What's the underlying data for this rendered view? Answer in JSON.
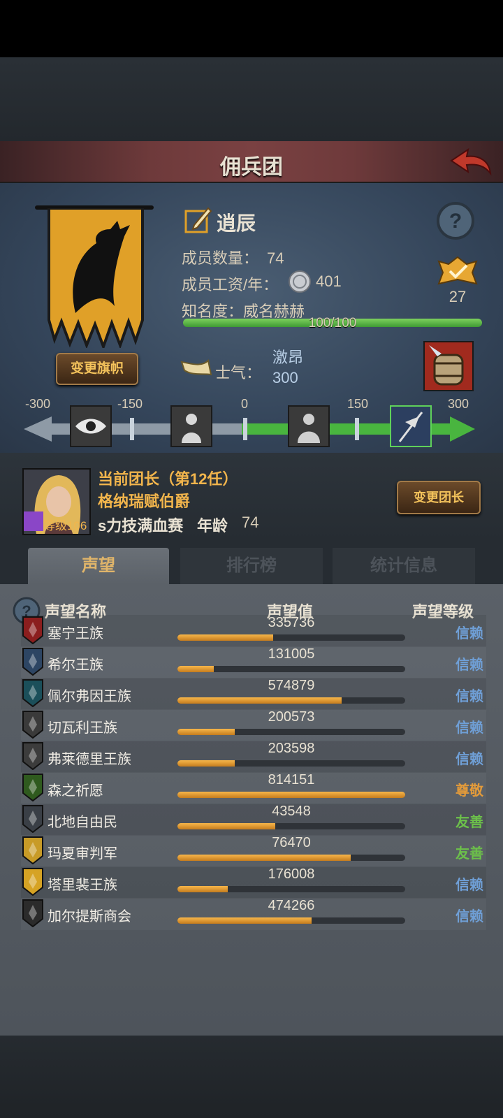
{
  "header": {
    "title": "佣兵团"
  },
  "guild": {
    "name": "逍辰",
    "members_label": "成员数量：",
    "members_value": "74",
    "salary_label": "成员工资/年：",
    "salary_value": "401",
    "fame_label": "知名度：",
    "fame_rank": "威名赫赫",
    "fame_progress_text": "100/100",
    "fame_progress": 1.0,
    "badge_count": "27",
    "change_banner_label": "变更旗帜"
  },
  "morale": {
    "label": "士气：",
    "state": "激昂",
    "value": "300",
    "ticks": [
      "-300",
      "-150",
      "0",
      "150",
      "300"
    ],
    "icons": [
      "watchful-eye-icon",
      "despair-figure-icon",
      "calm-figure-icon",
      "victory-flag-icon"
    ]
  },
  "leader": {
    "title": "当前团长（第12任）",
    "name": "格纳瑞赋伯爵",
    "level_label": "等级106",
    "extra": "s力技满血赛",
    "age_label": "年龄",
    "age_value": "74",
    "change_label": "变更团长"
  },
  "tabs": [
    {
      "label": "声望",
      "active": true
    },
    {
      "label": "排行榜",
      "active": false
    },
    {
      "label": "统计信息",
      "active": false
    }
  ],
  "reputation": {
    "headers": {
      "name": "声望名称",
      "value": "声望值",
      "level": "声望等级"
    },
    "rows": [
      {
        "name": "塞宁王族",
        "value": "335736",
        "fill": 0.42,
        "level": "信赖",
        "level_color": "#6f9fd6",
        "crest_color": "#8b1e1e"
      },
      {
        "name": "希尔王族",
        "value": "131005",
        "fill": 0.16,
        "level": "信赖",
        "level_color": "#6f9fd6",
        "crest_color": "#2d4563"
      },
      {
        "name": "佩尔弗因王族",
        "value": "574879",
        "fill": 0.72,
        "level": "信赖",
        "level_color": "#6f9fd6",
        "crest_color": "#1b4f5a"
      },
      {
        "name": "切瓦利王族",
        "value": "200573",
        "fill": 0.25,
        "level": "信赖",
        "level_color": "#6f9fd6",
        "crest_color": "#3a3a3a"
      },
      {
        "name": "弗莱德里王族",
        "value": "203598",
        "fill": 0.25,
        "level": "信赖",
        "level_color": "#6f9fd6",
        "crest_color": "#3c3c3c"
      },
      {
        "name": "森之祈愿",
        "value": "814151",
        "fill": 1.0,
        "level": "尊敬",
        "level_color": "#e39b3a",
        "crest_color": "#2f5a1e"
      },
      {
        "name": "北地自由民",
        "value": "43548",
        "fill": 0.43,
        "level": "友善",
        "level_color": "#6cc04a",
        "crest_color": "#3a3f46"
      },
      {
        "name": "玛夏审判军",
        "value": "76470",
        "fill": 0.76,
        "level": "友善",
        "level_color": "#6cc04a",
        "crest_color": "#c89b27"
      },
      {
        "name": "塔里裴王族",
        "value": "176008",
        "fill": 0.22,
        "level": "信赖",
        "level_color": "#6f9fd6",
        "crest_color": "#d6a324"
      },
      {
        "name": "加尔提斯商会",
        "value": "474266",
        "fill": 0.59,
        "level": "信赖",
        "level_color": "#6f9fd6",
        "crest_color": "#2b2b2b"
      }
    ]
  },
  "colors": {
    "accent_gold": "#f2b54c",
    "fame_green": "#5bb84a",
    "header_red": "#7a4142"
  }
}
